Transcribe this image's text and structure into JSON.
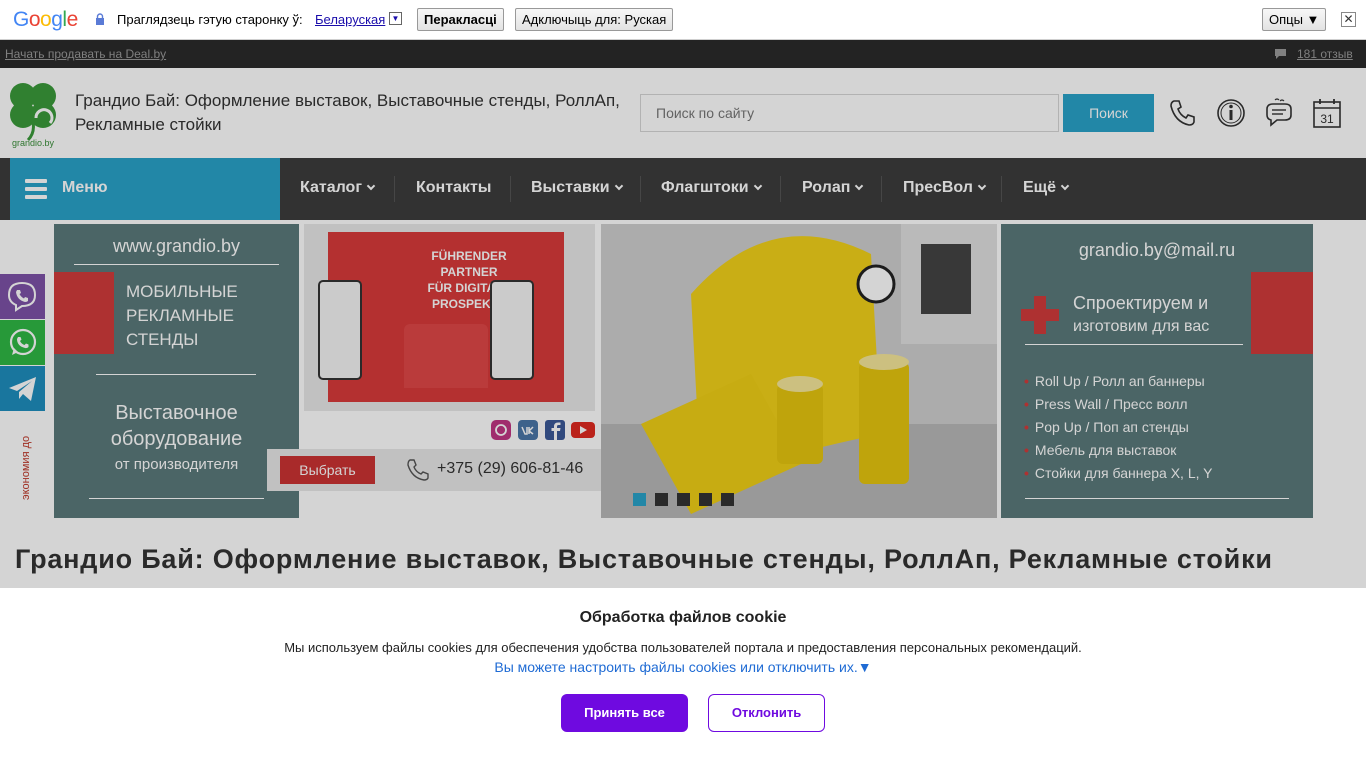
{
  "translate_bar": {
    "logo": [
      "G",
      "o",
      "o",
      "g",
      "l",
      "e"
    ],
    "logo_colors": [
      "#4285f4",
      "#ea4335",
      "#fbbc05",
      "#4285f4",
      "#34a853",
      "#ea4335"
    ],
    "prompt": "Праглядзець гэтую старонку ў:",
    "language": "Беларуская",
    "translate_button": "Перакласці",
    "disable_button": "Адключыць для: Руская",
    "options_button": "Опцы ▼",
    "close_icon": "✕"
  },
  "top_strip": {
    "sell_link": "Начать продавать на Deal.by",
    "reviews_link": "181 отзыв"
  },
  "header": {
    "logo_caption": "grandio.by",
    "title": "Грандио Бай: Оформление выставок, Выставочные стенды, РоллАп, Рекламные стойки",
    "search_placeholder": "Поиск по сайту",
    "search_button": "Поиск",
    "icons": [
      "phone-icon",
      "info-icon",
      "chat-icon",
      "calendar-icon"
    ],
    "calendar_day": "31"
  },
  "nav": {
    "menu_label": "Меню",
    "items": [
      {
        "label": "Каталог",
        "dropdown": true
      },
      {
        "label": "Контакты",
        "dropdown": false
      },
      {
        "label": "Выставки",
        "dropdown": true
      },
      {
        "label": "Флагштоки",
        "dropdown": true
      },
      {
        "label": "Ролап",
        "dropdown": true
      },
      {
        "label": "ПресВол",
        "dropdown": true
      },
      {
        "label": "Ещё",
        "dropdown": true
      }
    ]
  },
  "banner": {
    "left_site": "www.grandio.by",
    "left_heading": [
      "МОБИЛЬНЫЕ",
      "РЕКЛАМНЫЕ",
      "СТЕНДЫ"
    ],
    "left_sub": [
      "Выставочное",
      "оборудование",
      "от производителя"
    ],
    "choose_button": "Выбрать",
    "phone": "+375 (29) 606-81-46",
    "right_email": "grandio.by@mail.ru",
    "right_heading": [
      "Спроектируем и",
      "изготовим для вас"
    ],
    "bullets": [
      "Roll Up / Ролл ап баннеры",
      "Press Wall / Пресс волл",
      "Pop Up / Поп ап стенды",
      "Мебель для выставок",
      "Стойки для баннера X, L, Y"
    ],
    "mid_headline": [
      "FÜHRENDER",
      "PARTNER",
      "FÜR DIGITALE",
      "PROSPEKTE"
    ],
    "vertical_text": "экономия до",
    "slides_total": 5,
    "active_slide": 1
  },
  "social": [
    "viber-icon",
    "whatsapp-icon",
    "telegram-icon"
  ],
  "page_heading": "Грандио Бай: Оформление выставок, Выставочные стенды, РоллАп, Рекламные стойки",
  "cookie": {
    "title": "Обработка файлов cookie",
    "text": "Мы используем файлы cookies для обеспечения удобства пользователей портала и предоставления персональных рекомендаций.",
    "settings_link": "Вы можете настроить файлы cookies или отключить их.▼",
    "accept_button": "Принять все",
    "decline_button": "Отклонить"
  },
  "colors": {
    "accent": "#2aa3c9",
    "nav_bg": "#3d3d3d",
    "cookie_accent": "#6f0ae0",
    "banner_teal": "#5b7a7b",
    "banner_red": "#d23b3b"
  }
}
